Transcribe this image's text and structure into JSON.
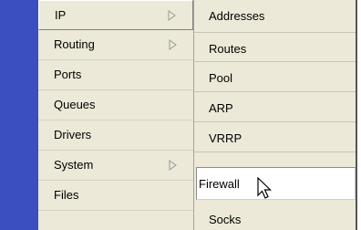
{
  "main_menu": {
    "items": [
      {
        "label": "IP",
        "submenu": true
      },
      {
        "label": "Routing",
        "submenu": true
      },
      {
        "label": "Ports",
        "submenu": false
      },
      {
        "label": "Queues",
        "submenu": false
      },
      {
        "label": "Drivers",
        "submenu": false
      },
      {
        "label": "System",
        "submenu": true
      },
      {
        "label": "Files",
        "submenu": false
      }
    ]
  },
  "sub_menu": {
    "items": [
      {
        "label": "Addresses"
      },
      {
        "label": "Routes"
      },
      {
        "label": "Pool"
      },
      {
        "label": "ARP"
      },
      {
        "label": "VRRP"
      },
      {
        "label": "Firewall"
      },
      {
        "label": "Socks"
      }
    ]
  },
  "colors": {
    "sidebar_accent": "#3c4fc0",
    "menu_background": "#ece9d8"
  },
  "icons": {
    "submenu_arrow": "chevron-right-icon",
    "cursor": "arrow-cursor-icon"
  }
}
